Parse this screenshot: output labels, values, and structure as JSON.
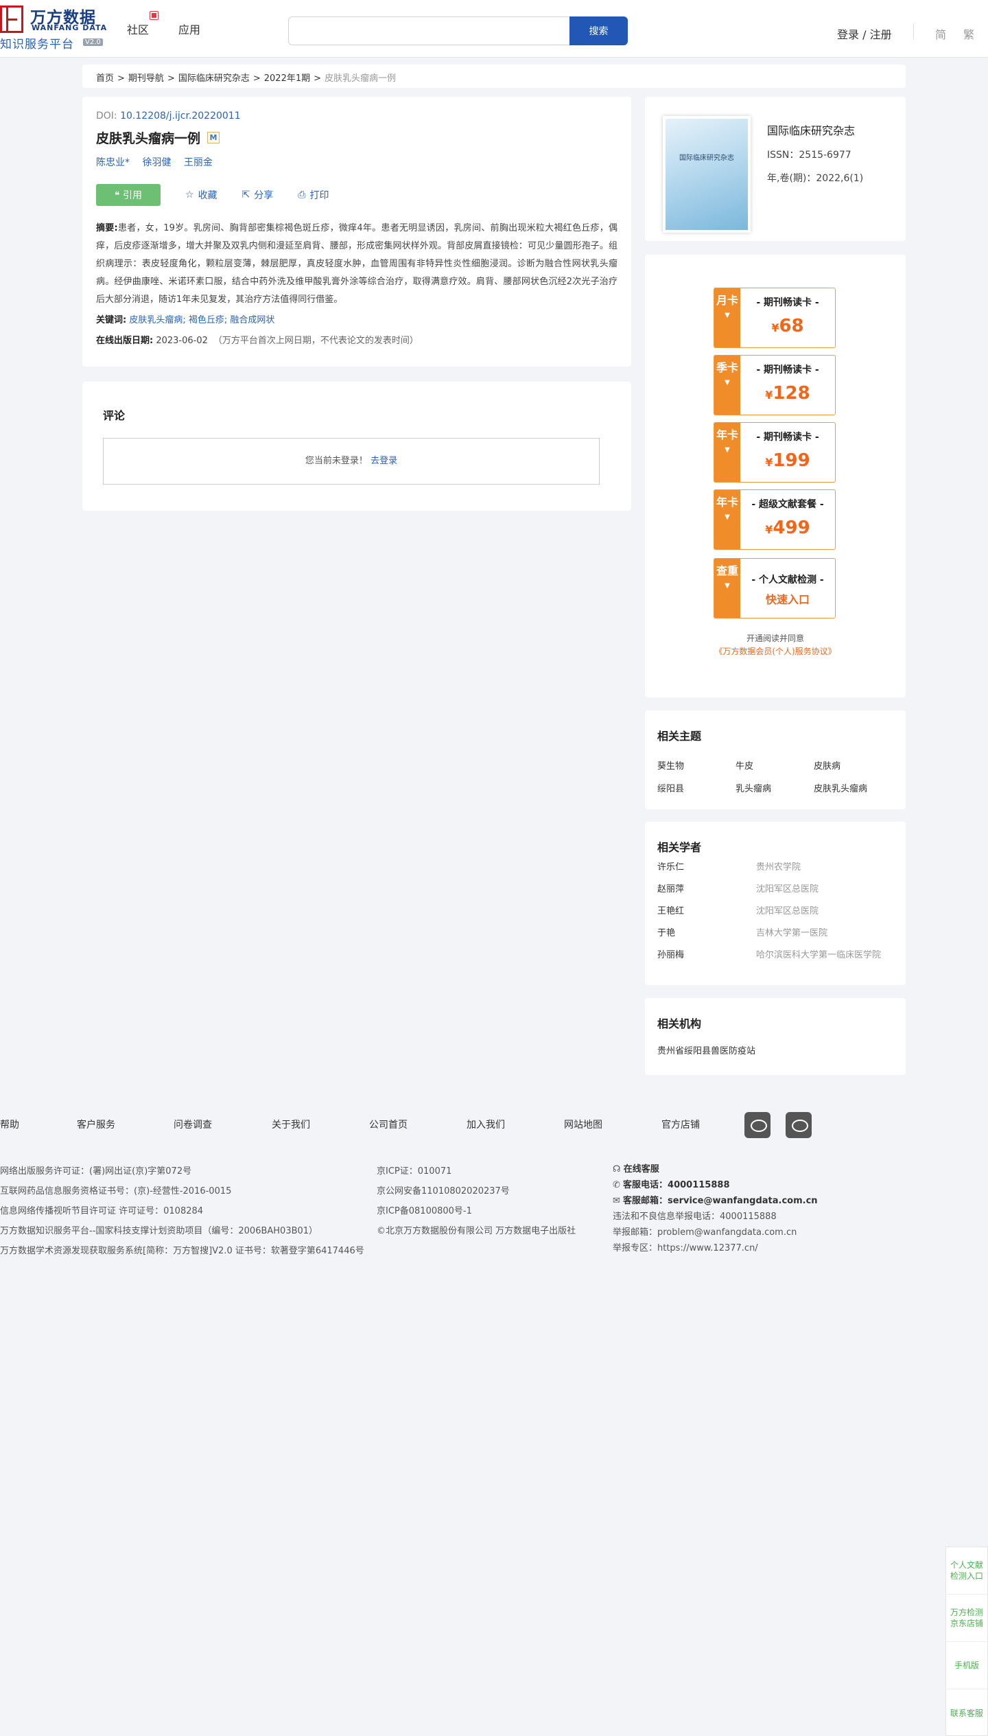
{
  "header": {
    "logo_cn": "万方数据",
    "logo_en": "WANFANG DATA",
    "logo_sub": "知识服务平台",
    "logo_version": "V2.0",
    "nav": [
      "社区",
      "应用"
    ],
    "search_placeholder": "",
    "search_button": "搜索",
    "login": "登录 / 注册",
    "lang_simplified": "简",
    "lang_traditional": "繁"
  },
  "breadcrumb": [
    "首页",
    "期刊导航",
    "国际临床研究杂志",
    "2022年1期",
    "皮肤乳头瘤病一例"
  ],
  "article": {
    "doi_label": "DOI:",
    "doi": "10.12208/j.ijcr.20220011",
    "title": "皮肤乳头瘤病一例",
    "title_badge": "M",
    "authors": [
      "陈忠业*",
      "徐羽健",
      "王丽金"
    ],
    "actions": {
      "cite": "引用",
      "favorite": "收藏",
      "share": "分享",
      "print": "打印"
    },
    "abstract_label": "摘要:",
    "abstract": "患者，女，19岁。乳房间、胸背部密集棕褐色斑丘疹，微痒4年。患者无明显诱因，乳房间、前胸出现米粒大褐红色丘疹，偶痒，后皮疹逐渐增多，增大并聚及双乳内侧和漫延至肩背、腰部，形成密集网状样外观。背部皮屑直接镜检：可见少量圆形孢子。组织病理示：表皮轻度角化，颗粒层变薄，棘层肥厚，真皮轻度水肿，血管周围有非特异性炎性细胞浸润。诊断为融合性网状乳头瘤病。经伊曲康唑、米诺环素口服，结合中药外洗及维甲酸乳膏外涂等综合治疗，取得满意疗效。肩背、腰部网状色沉经2次光子治疗后大部分消退，随访1年未见复发，其治疗方法值得同行借鉴。",
    "keywords_label": "关键词:",
    "keywords": [
      "皮肤乳头瘤病;",
      "褐色丘疹;",
      "融合成网状"
    ],
    "date_label": "在线出版日期:",
    "date": "2023-06-02",
    "date_note": "（万方平台首次上网日期，不代表论文的发表时间）"
  },
  "comment": {
    "title": "评论",
    "not_logged": "您当前未登录！",
    "login_link": "去登录"
  },
  "journal": {
    "cover_text": "国际临床研究杂志",
    "name": "国际临床研究杂志",
    "issn": "ISSN：2515-6977",
    "volume": "年,卷(期)：2022,6(1)"
  },
  "vip": [
    {
      "tag": "月卡",
      "title": "- 期刊畅读卡 -",
      "price": "68"
    },
    {
      "tag": "季卡",
      "title": "- 期刊畅读卡 -",
      "price": "128"
    },
    {
      "tag": "年卡",
      "title": "- 期刊畅读卡 -",
      "price": "199"
    },
    {
      "tag": "年卡",
      "title": "- 超级文献套餐 -",
      "price": "499"
    },
    {
      "tag": "查重",
      "title": "- 个人文献检测 -",
      "quick": "快速入口"
    }
  ],
  "vip_currency": "¥",
  "vip_agree_1": "开通阅读并同意",
  "vip_agree_2": "《万方数据会员(个人)服务协议》",
  "topics": {
    "title": "相关主题",
    "items": [
      "葵生物",
      "牛皮",
      "皮肤病",
      "绥阳县",
      "乳头瘤病",
      "皮肤乳头瘤病"
    ]
  },
  "scholars": {
    "title": "相关学者",
    "items": [
      {
        "name": "许乐仁",
        "org": "贵州农学院"
      },
      {
        "name": "赵丽萍",
        "org": "沈阳军区总医院"
      },
      {
        "name": "王艳红",
        "org": "沈阳军区总医院"
      },
      {
        "name": "于艳",
        "org": "吉林大学第一医院"
      },
      {
        "name": "孙丽梅",
        "org": "哈尔滨医科大学第一临床医学院"
      }
    ]
  },
  "orgs": {
    "title": "相关机构",
    "items": [
      "贵州省绥阳县兽医防疫站"
    ]
  },
  "footer": {
    "links": [
      "帮助",
      "客户服务",
      "问卷调查",
      "关于我们",
      "公司首页",
      "加入我们",
      "网站地图",
      "官方店铺"
    ],
    "col1": [
      "网络出版服务许可证：(署)网出证(京)字第072号",
      "互联网药品信息服务资格证书号：(京)-经营性-2016-0015",
      "信息网络传播视听节目许可证 许可证号：0108284",
      "万方数据知识服务平台--国家科技支撑计划资助项目（编号：2006BAH03B01）",
      "万方数据学术资源发现获取服务系统[简称：万方智搜]V2.0 证书号：软著登字第6417446号"
    ],
    "col2": [
      "京ICP证：010071",
      "京公网安备11010802020237号",
      "京ICP备08100800号-1",
      "©北京万方数据股份有限公司 万方数据电子出版社"
    ],
    "col3": {
      "online": "在线客服",
      "phone": "客服电话：4000115888",
      "email": "客服邮箱：service@wanfangdata.com.cn",
      "report_phone": "违法和不良信息举报电话：4000115888",
      "report_email": "举报邮箱：problem@wanfangdata.com.cn",
      "report_site": "举报专区：https://www.12377.cn/"
    }
  },
  "float": [
    "个人文献检测入口",
    "万方检测京东店铺",
    "手机版",
    "联系客服"
  ]
}
